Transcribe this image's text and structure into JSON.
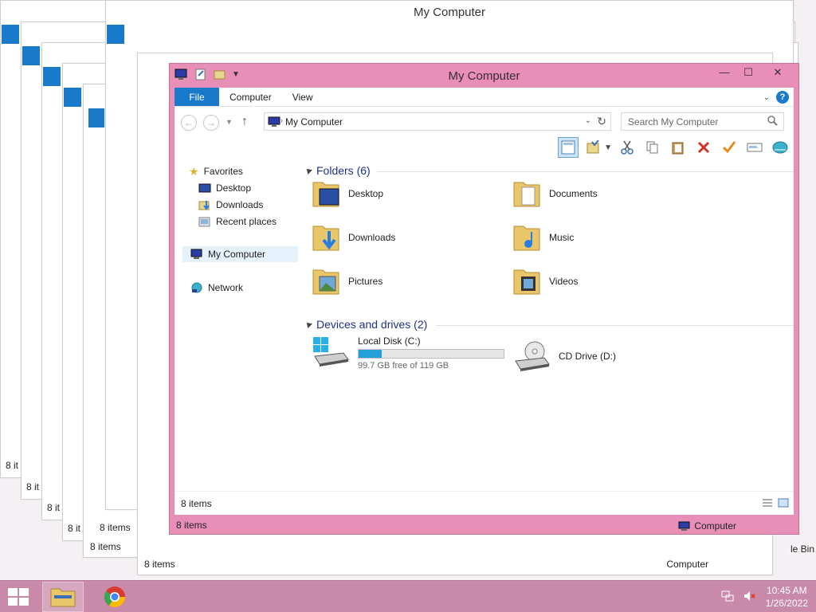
{
  "window": {
    "title": "My Computer",
    "ribbon_tabs": [
      "File",
      "Computer",
      "View"
    ],
    "address": "My Computer",
    "search_placeholder": "Search My Computer",
    "status_count": "8 items",
    "status_location": "Computer"
  },
  "nav": {
    "favorites": "Favorites",
    "desktop": "Desktop",
    "downloads": "Downloads",
    "recent": "Recent places",
    "computer": "My Computer",
    "network": "Network"
  },
  "folders": {
    "header": "Folders (6)",
    "items": [
      "Desktop",
      "Documents",
      "Downloads",
      "Music",
      "Pictures",
      "Videos"
    ]
  },
  "drives": {
    "header": "Devices and drives (2)",
    "local": {
      "label": "Local Disk (C:)",
      "free": "99.7 GB free of 119 GB",
      "used_fraction": 0.16
    },
    "cd": {
      "label": "CD Drive (D:)"
    }
  },
  "ghost": {
    "title": "My Computer",
    "items": "8 items",
    "status_short": "8 it",
    "computer": "Computer"
  },
  "taskbar": {
    "time": "10:45 AM",
    "date": "1/26/2022"
  },
  "desktop": {
    "recycle_fragment": "le Bin"
  },
  "colors": {
    "accent": "#1979ca",
    "window_frame": "#e88fb8",
    "taskbar": "#c98aa9",
    "progress": "#26a0da"
  }
}
